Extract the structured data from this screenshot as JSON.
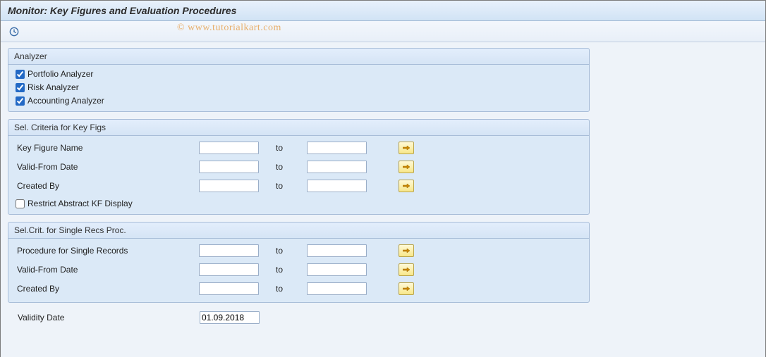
{
  "page_title": "Monitor: Key Figures and Evaluation Procedures",
  "watermark": "© www.tutorialkart.com",
  "analyzer": {
    "title": "Analyzer",
    "portfolio_label": "Portfolio Analyzer",
    "risk_label": "Risk Analyzer",
    "accounting_label": "Accounting Analyzer"
  },
  "sel_key_figs": {
    "title": "Sel. Criteria for Key Figs",
    "key_figure_label": "Key Figure Name",
    "valid_from_label": "Valid-From Date",
    "created_by_label": "Created By",
    "restrict_label": "Restrict Abstract KF Display",
    "to_text": "to"
  },
  "sel_single_recs": {
    "title": "Sel.Crit. for Single Recs Proc.",
    "procedure_label": "Procedure for Single Records",
    "valid_from_label": "Valid-From Date",
    "created_by_label": "Created By",
    "to_text": "to"
  },
  "validity": {
    "label": "Validity Date",
    "value": "01.09.2018"
  }
}
